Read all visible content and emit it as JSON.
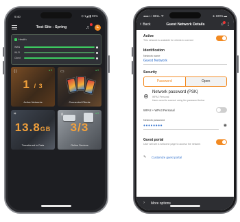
{
  "left_phone": {
    "status": {
      "time": "9:40",
      "indicators": "⊙ ▾◢ ▮ 95%"
    },
    "header": {
      "title": "Test Site - Spring",
      "avatar_initial": "L"
    },
    "health": {
      "label": "Health",
      "rows": [
        {
          "key": "WAN"
        },
        {
          "key": "Wi-Fi"
        },
        {
          "key": "Client"
        }
      ]
    },
    "tiles": [
      {
        "id": "active-networks",
        "value": "1",
        "value_sub": "/ 3",
        "caption": "Active Networks",
        "tag": "● 3",
        "icon": "share-icon"
      },
      {
        "id": "connected-clients",
        "value": "",
        "caption": "Connected Clients",
        "tag": "● 3",
        "icon": "monitor-icon"
      },
      {
        "id": "transferred-data",
        "value": "13.8",
        "value_sub": "GB",
        "caption": "Transferred in Data",
        "tag": "",
        "icon": "chart-icon"
      },
      {
        "id": "online-devices",
        "value": "3/3",
        "caption": "Online Devices",
        "tag": "● 3",
        "icon": "network-icon"
      }
    ],
    "colors": {
      "accent": "#f28a22",
      "health": "#3dcf62",
      "number": "#f3a13b"
    }
  },
  "right_phone": {
    "status": {
      "carrier": "●●●○○ BELL ᯤ",
      "time": "4:21 PM",
      "battery": "∗ 100% ▬"
    },
    "header": {
      "back_label": "Back",
      "title": "Guest Network Details",
      "badge": "●"
    },
    "active": {
      "title": "Active",
      "subtitle": "This network is available for clients to connect",
      "on": true
    },
    "identification": {
      "title": "Identification",
      "network_name_label": "Network name",
      "network_name_value": "Guest Network"
    },
    "security": {
      "title": "Security",
      "segments": [
        "Password",
        "Open"
      ],
      "selected": "Password",
      "password_option": {
        "title": "Network password (PSK)",
        "line1": "WPA2 Personal",
        "line2": "Users need to connect using the password below"
      },
      "wpa_toggle_label": "WPA2 + WPA3 Personal",
      "wpa_toggle_on": false,
      "network_password_label": "Network password",
      "network_password_value": "●●●●●●●●"
    },
    "guest_portal": {
      "title": "Guest portal",
      "subtitle": "User will see a welcome page to access the network",
      "on": true,
      "customize_link": "Customize guest portal"
    },
    "more_options": "More options",
    "colors": {
      "accent": "#f28a22",
      "link": "#2f6fcc",
      "header_bg": "#2d2e32"
    }
  }
}
